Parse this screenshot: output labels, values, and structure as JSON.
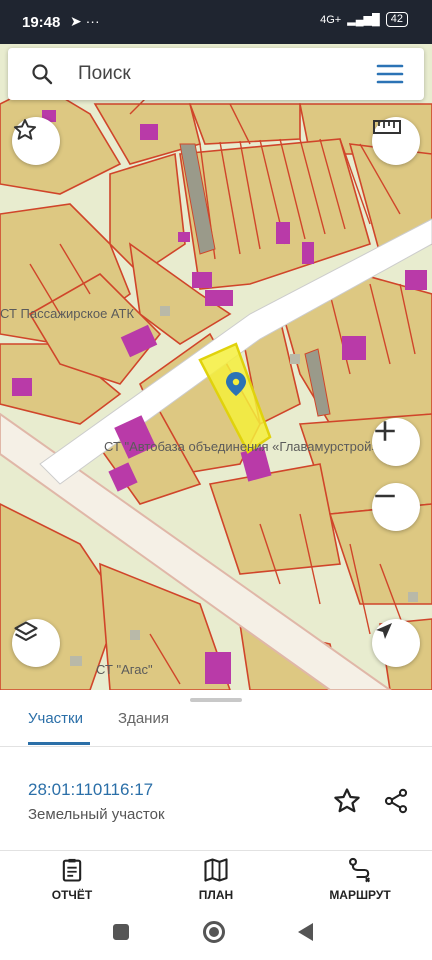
{
  "status_bar": {
    "time": "19:48",
    "left_icons": "➤ ···",
    "network": "4G+",
    "battery": "42"
  },
  "search": {
    "placeholder": "Поиск"
  },
  "map": {
    "labels": [
      "СТ Пассажирское АТК",
      "СТ \"Автобаза объединения «Главамурстрой»\"",
      "СТ \"Агас\""
    ],
    "colors": {
      "background": "#eaeed6",
      "parcel_fill": "#ddc882",
      "parcel_border": "#d0452a",
      "building": "#b93aa8",
      "road": "#ffffff",
      "selected_fill": "#f4ef3c",
      "marker": "#2b73b5"
    }
  },
  "sheet": {
    "tabs": [
      "Участки",
      "Здания"
    ],
    "active_tab": "Участки",
    "parcel_id": "28:01:110116:17",
    "parcel_type": "Земельный участок",
    "actions": {
      "report": "ОТЧЁТ",
      "plan": "ПЛАН",
      "route": "МАРШРУТ"
    }
  },
  "icons": [
    "search-icon",
    "menu-icon",
    "star-icon",
    "ruler-icon",
    "zoom-in-icon",
    "zoom-out-icon",
    "layers-icon",
    "locate-icon",
    "share-icon",
    "report-icon",
    "map-icon",
    "route-icon"
  ]
}
